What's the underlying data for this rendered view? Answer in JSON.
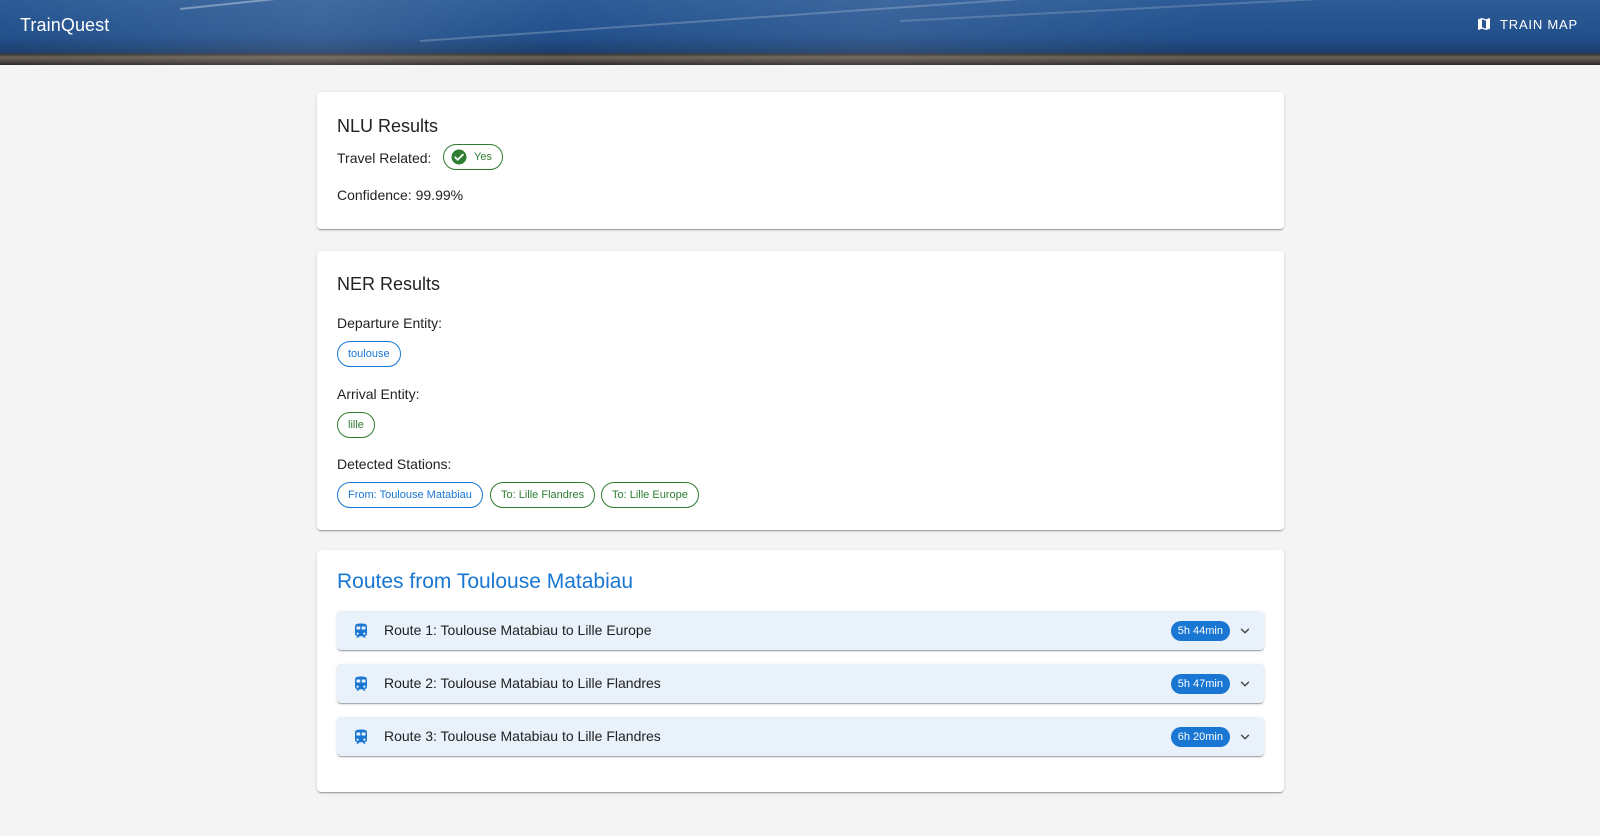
{
  "app": {
    "title": "TrainQuest",
    "map_button": "TRAIN MAP"
  },
  "nlu": {
    "title": "NLU Results",
    "travel_label": "Travel Related:",
    "travel_value": "Yes",
    "confidence": "Confidence: 99.99%"
  },
  "ner": {
    "title": "NER Results",
    "departure_label": "Departure Entity:",
    "departure_value": "toulouse",
    "arrival_label": "Arrival Entity:",
    "arrival_value": "lille",
    "stations_label": "Detected Stations:",
    "stations": [
      {
        "text": "From: Toulouse Matabiau",
        "color": "#1976d2"
      },
      {
        "text": "To: Lille Flandres",
        "color": "#2e7d32"
      },
      {
        "text": "To: Lille Europe",
        "color": "#2e7d32"
      }
    ]
  },
  "routes": {
    "title": "Routes from Toulouse Matabiau",
    "items": [
      {
        "label": "Route 1: Toulouse Matabiau to Lille Europe",
        "duration": "5h 44min"
      },
      {
        "label": "Route 2: Toulouse Matabiau to Lille Flandres",
        "duration": "5h 47min"
      },
      {
        "label": "Route 3: Toulouse Matabiau to Lille Flandres",
        "duration": "6h 20min"
      }
    ]
  },
  "colors": {
    "primary": "#1976d2",
    "success": "#2e7d32",
    "route_bg": "#e9f1fb"
  },
  "icons": {
    "map": "map-icon",
    "check": "check-circle-icon",
    "train": "train-icon",
    "expand": "chevron-down-icon"
  }
}
